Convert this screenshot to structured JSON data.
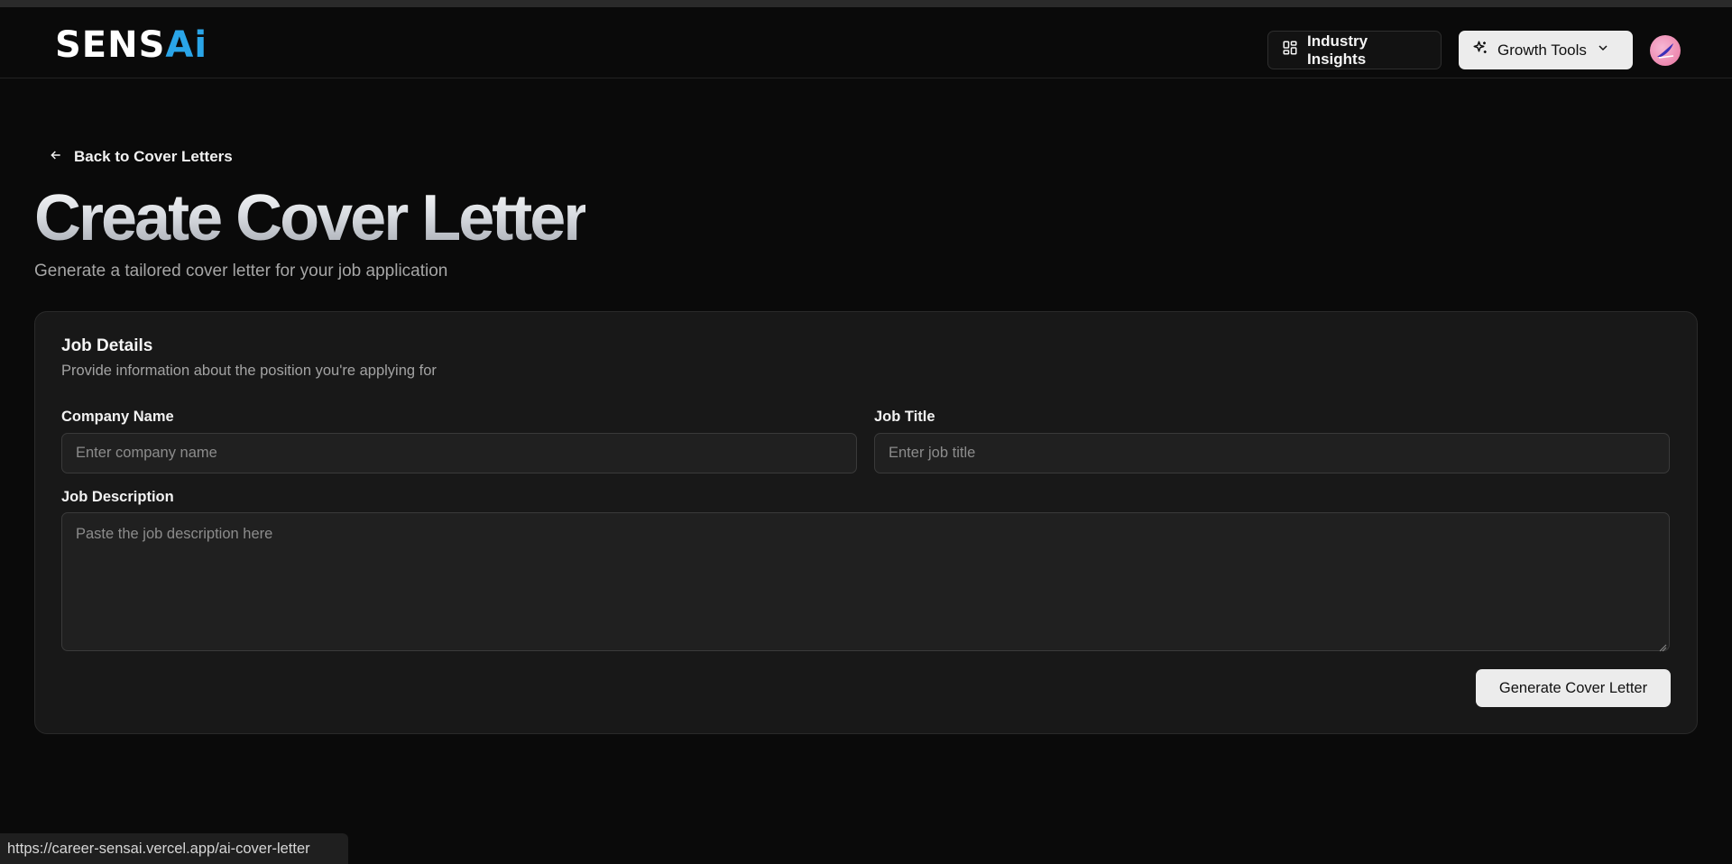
{
  "header": {
    "logo_text_main": "SENS",
    "logo_text_ai": "Ai",
    "industry_insights_label": "Industry Insights",
    "growth_tools_label": "Growth Tools"
  },
  "nav": {
    "back_label": "Back to Cover Letters"
  },
  "page": {
    "title": "Create Cover Letter",
    "subtitle": "Generate a tailored cover letter for your job application"
  },
  "form": {
    "card_title": "Job Details",
    "card_description": "Provide information about the position you're applying for",
    "company_label": "Company Name",
    "company_placeholder": "Enter company name",
    "company_value": "",
    "job_title_label": "Job Title",
    "job_title_placeholder": "Enter job title",
    "job_title_value": "",
    "job_description_label": "Job Description",
    "job_description_placeholder": "Paste the job description here",
    "job_description_value": "",
    "submit_label": "Generate Cover Letter"
  },
  "status_bar": {
    "url": "https://career-sensai.vercel.app/ai-cover-letter"
  },
  "icons": {
    "insights": "layout-dashboard-icon",
    "growth": "sparkles-icon",
    "chevron": "chevron-down-icon",
    "back": "arrow-left-icon"
  },
  "colors": {
    "background": "#0a0a0a",
    "card": "#181818",
    "logo_accent": "#2aa5e8",
    "button_light": "#ececec"
  }
}
